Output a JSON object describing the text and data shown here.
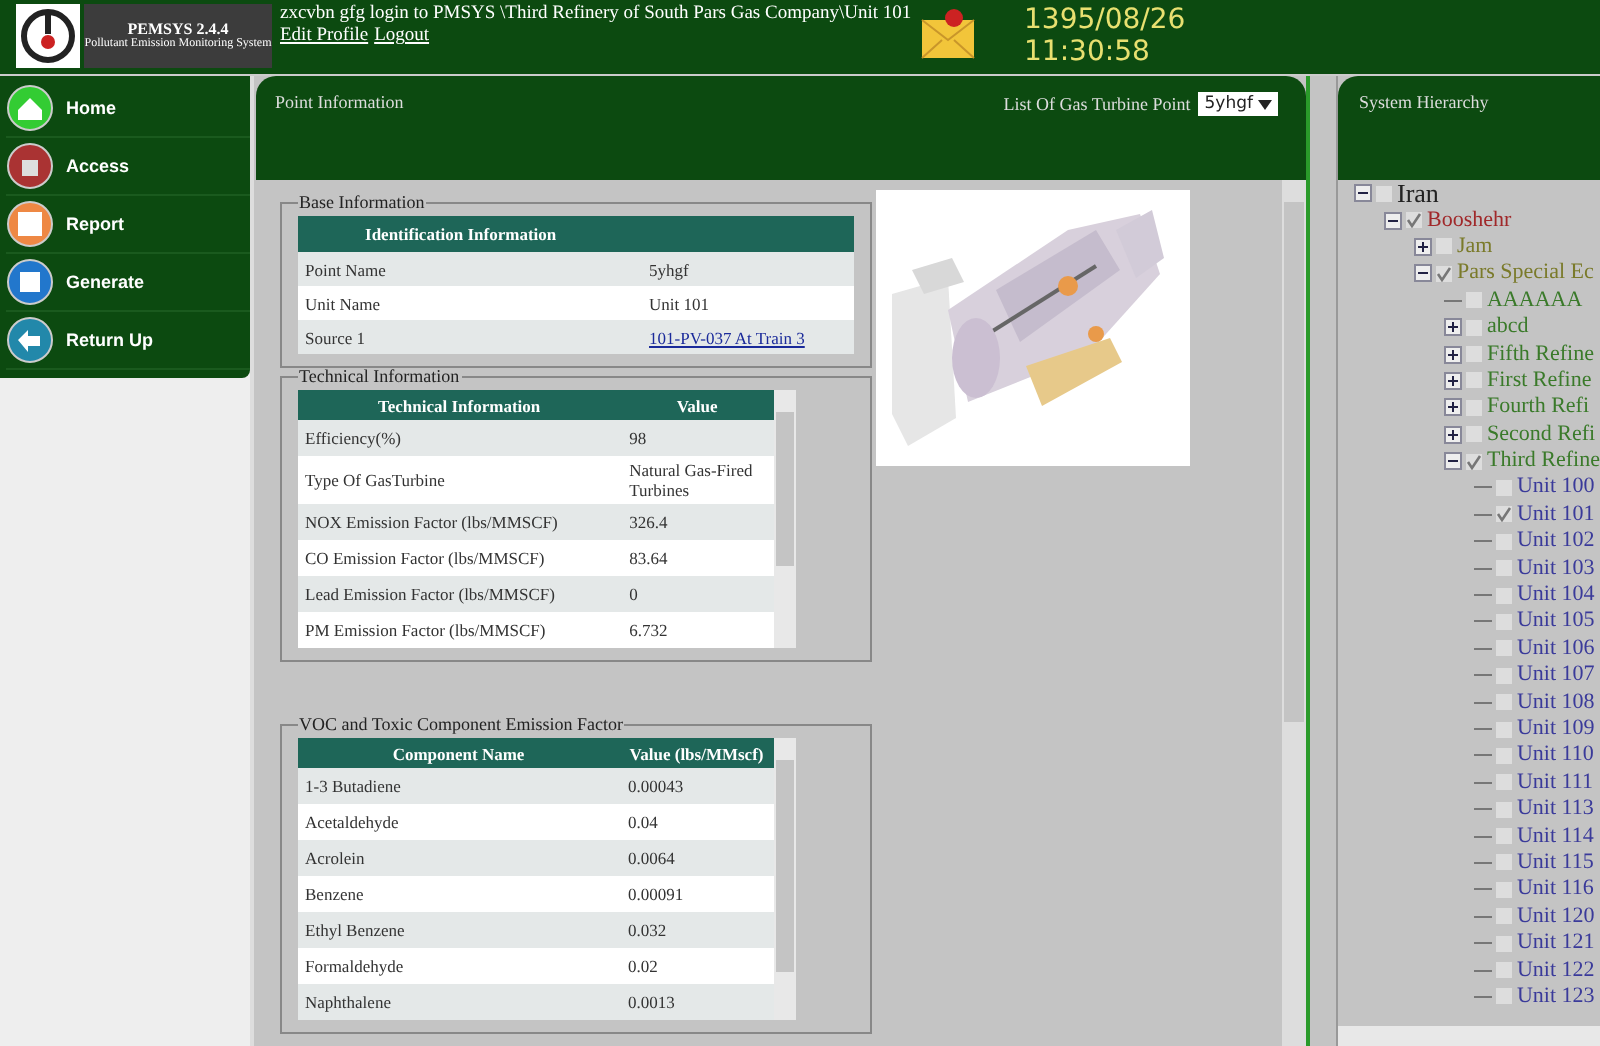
{
  "header": {
    "app_name": "PEMSYS 2.4.4",
    "app_subtitle": "Pollutant Emission Monitoring System",
    "login_text": "zxcvbn gfg login to PMSYS \\Third Refinery of South Pars Gas Company\\Unit 101",
    "links": [
      "Edit Profile",
      "Logout"
    ],
    "date": "1395/08/26",
    "time": "11:30:58"
  },
  "menu": [
    {
      "label": "Home",
      "kind": "home"
    },
    {
      "label": "Access",
      "kind": "access"
    },
    {
      "label": "Report",
      "kind": "report"
    },
    {
      "label": "Generate",
      "kind": "generate"
    },
    {
      "label": "Return Up",
      "kind": "return"
    }
  ],
  "point_panel": {
    "title": "Point Information",
    "selector_label": "List Of Gas Turbine Point",
    "selector_value": "5yhgf",
    "base": {
      "legend": "Base Information",
      "heading": "Identification Information",
      "rows": [
        {
          "label": "Point Name",
          "value": "5yhgf",
          "kind": "text"
        },
        {
          "label": "Unit Name",
          "value": "Unit 101",
          "kind": "text"
        },
        {
          "label": "Source 1",
          "value": "101-PV-037 At Train 3",
          "kind": "link"
        }
      ]
    },
    "technical": {
      "legend": "Technical Information",
      "columns": [
        "Technical Information",
        "Value"
      ],
      "rows": [
        [
          "Efficiency(%)",
          "98"
        ],
        [
          "Type Of GasTurbine",
          "Natural Gas-Fired Turbines"
        ],
        [
          "NOX Emission Factor (lbs/MMSCF)",
          "326.4"
        ],
        [
          "CO Emission Factor (lbs/MMSCF)",
          "83.64"
        ],
        [
          "Lead Emission Factor (lbs/MMSCF)",
          "0"
        ],
        [
          "PM Emission Factor (lbs/MMSCF)",
          "6.732"
        ]
      ]
    },
    "voc": {
      "legend": "VOC and Toxic Component Emission Factor",
      "columns": [
        "Component Name",
        "Value (lbs/MMscf)"
      ],
      "rows": [
        [
          "1-3 Butadiene",
          "0.00043"
        ],
        [
          "Acetaldehyde",
          "0.04"
        ],
        [
          "Acrolein",
          "0.0064"
        ],
        [
          "Benzene",
          "0.00091"
        ],
        [
          "Ethyl Benzene",
          "0.032"
        ],
        [
          "Formaldehyde",
          "0.02"
        ],
        [
          "Naphthalene",
          "0.0013"
        ]
      ]
    }
  },
  "hierarchy": {
    "title": "System Hierarchy",
    "tree": [
      {
        "label": "Iran",
        "checked": false,
        "expanded": true,
        "children": [
          {
            "label": "Booshehr",
            "checked": true,
            "expanded": true,
            "children": [
              {
                "label": "Jam",
                "checked": false,
                "expanded": false
              },
              {
                "label": "Pars Special Ec",
                "checked": true,
                "expanded": true,
                "children": [
                  {
                    "label": "AAAAAA",
                    "checked": false
                  },
                  {
                    "label": "abcd",
                    "checked": false,
                    "expanded": false
                  },
                  {
                    "label": "Fifth Refine",
                    "checked": false,
                    "expanded": false
                  },
                  {
                    "label": "First Refine",
                    "checked": false,
                    "expanded": false
                  },
                  {
                    "label": "Fourth Refi",
                    "checked": false,
                    "expanded": false
                  },
                  {
                    "label": "Second Refi",
                    "checked": false,
                    "expanded": false
                  },
                  {
                    "label": "Third Refine",
                    "checked": true,
                    "expanded": true,
                    "children": [
                      {
                        "label": "Unit 100",
                        "checked": false
                      },
                      {
                        "label": "Unit 101",
                        "checked": true
                      },
                      {
                        "label": "Unit 102",
                        "checked": false
                      },
                      {
                        "label": "Unit 103",
                        "checked": false
                      },
                      {
                        "label": "Unit 104",
                        "checked": false
                      },
                      {
                        "label": "Unit 105",
                        "checked": false
                      },
                      {
                        "label": "Unit 106",
                        "checked": false
                      },
                      {
                        "label": "Unit 107",
                        "checked": false
                      },
                      {
                        "label": "Unit 108",
                        "checked": false
                      },
                      {
                        "label": "Unit 109",
                        "checked": false
                      },
                      {
                        "label": "Unit 110",
                        "checked": false
                      },
                      {
                        "label": "Unit 111",
                        "checked": false
                      },
                      {
                        "label": "Unit 113",
                        "checked": false
                      },
                      {
                        "label": "Unit 114",
                        "checked": false
                      },
                      {
                        "label": "Unit 115",
                        "checked": false
                      },
                      {
                        "label": "Unit 116",
                        "checked": false
                      },
                      {
                        "label": "Unit 120",
                        "checked": false
                      },
                      {
                        "label": "Unit 121",
                        "checked": false
                      },
                      {
                        "label": "Unit 122",
                        "checked": false
                      },
                      {
                        "label": "Unit 123",
                        "checked": false
                      }
                    ]
                  }
                ]
              }
            ]
          }
        ]
      }
    ]
  }
}
